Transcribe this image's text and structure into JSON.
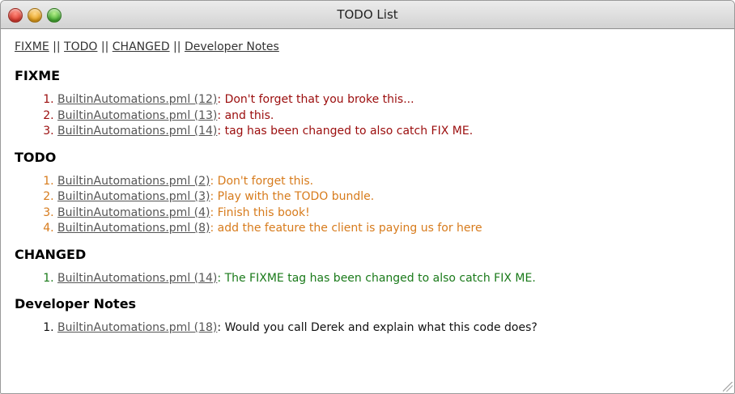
{
  "window": {
    "title": "TODO List"
  },
  "nav": {
    "links": [
      "FIXME",
      "TODO",
      "CHANGED",
      "Developer Notes"
    ],
    "separator": "||"
  },
  "sections": {
    "fixme": {
      "heading": "FIXME",
      "color": "#9b0d0d",
      "items": [
        {
          "link": "BuiltinAutomations.pml (12)",
          "text": ": Don't forget that you broke this..."
        },
        {
          "link": "BuiltinAutomations.pml (13)",
          "text": ": and this."
        },
        {
          "link": "BuiltinAutomations.pml (14)",
          "text": ": tag has been changed to also catch FIX ME."
        }
      ]
    },
    "todo": {
      "heading": "TODO",
      "color": "#d77b1c",
      "items": [
        {
          "link": "BuiltinAutomations.pml (2)",
          "text": ": Don't forget this."
        },
        {
          "link": "BuiltinAutomations.pml (3)",
          "text": ": Play with the TODO bundle."
        },
        {
          "link": "BuiltinAutomations.pml (4)",
          "text": ": Finish this book!"
        },
        {
          "link": "BuiltinAutomations.pml (8)",
          "text": ": add the feature the client is paying us for here"
        }
      ]
    },
    "changed": {
      "heading": "CHANGED",
      "color": "#1a7a1a",
      "items": [
        {
          "link": "BuiltinAutomations.pml (14)",
          "text": ": The FIXME tag has been changed to also catch FIX ME."
        }
      ]
    },
    "notes": {
      "heading": "Developer Notes",
      "color": "#111111",
      "items": [
        {
          "link": "BuiltinAutomations.pml (18)",
          "text": ": Would you call Derek and explain what this code does?"
        }
      ]
    }
  }
}
